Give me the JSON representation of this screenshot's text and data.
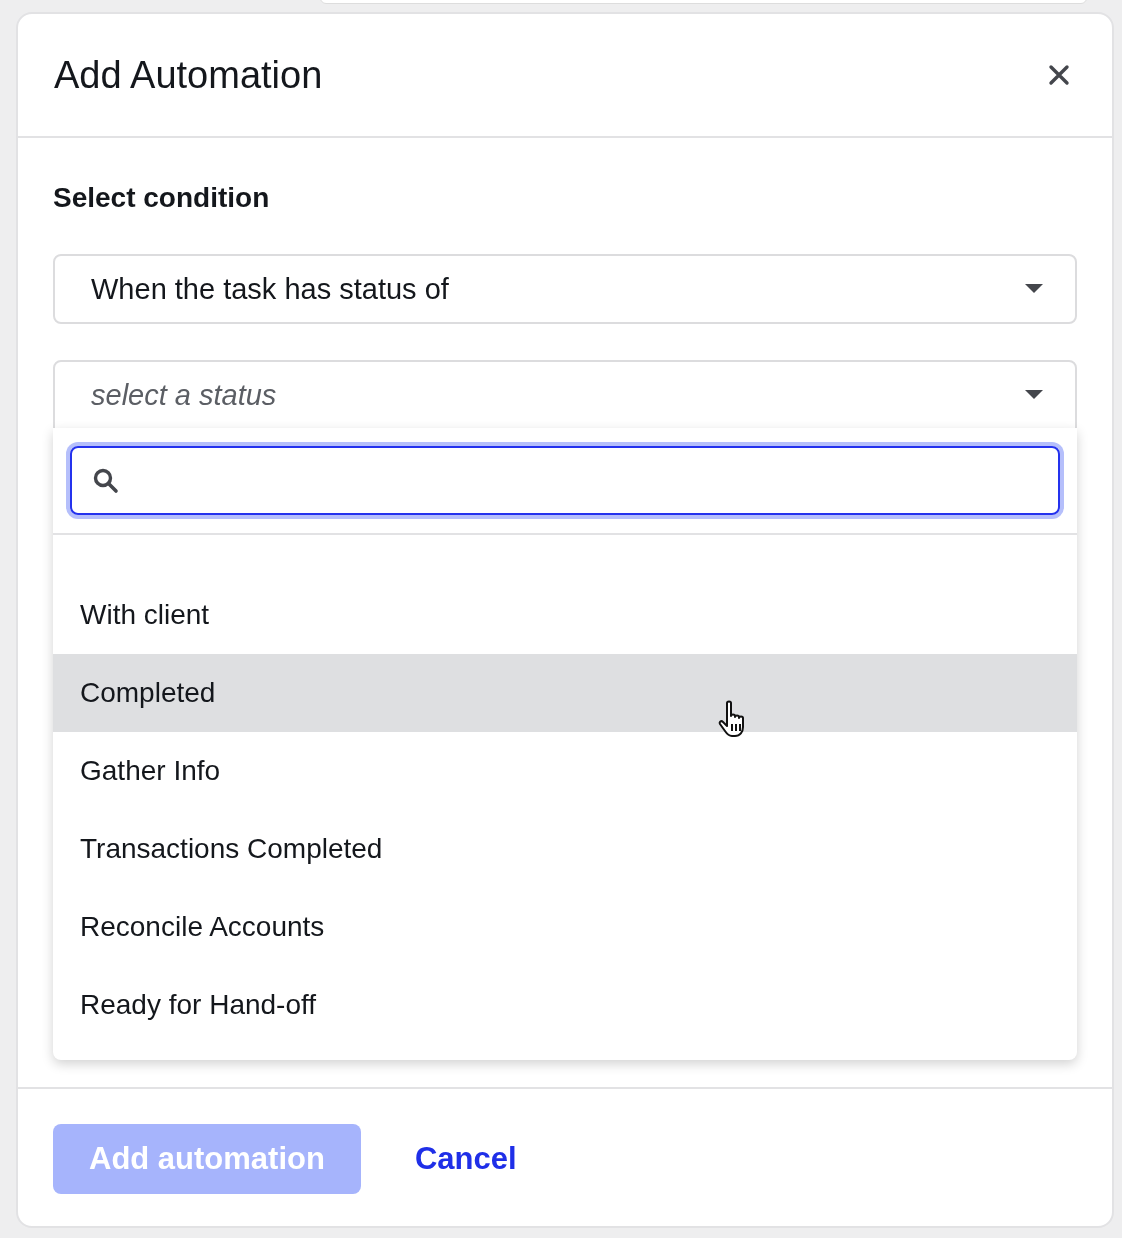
{
  "dialog": {
    "title": "Add Automation"
  },
  "section_label": "Select condition",
  "condition_select": {
    "value": "When the task has status of"
  },
  "status_select": {
    "placeholder": "select a status",
    "expanded": true
  },
  "status_search": {
    "focused": true
  },
  "status_options": [
    {
      "label": "With client",
      "highlighted": false
    },
    {
      "label": "Completed",
      "highlighted": true
    },
    {
      "label": "Gather Info",
      "highlighted": false
    },
    {
      "label": "Transactions Completed",
      "highlighted": false
    },
    {
      "label": "Reconcile Accounts",
      "highlighted": false
    },
    {
      "label": "Ready for Hand-off",
      "highlighted": false
    }
  ],
  "footer_buttons": [
    {
      "label": "Add automation",
      "kind": "primary",
      "disabled": true
    },
    {
      "label": "Cancel",
      "kind": "link",
      "disabled": false
    }
  ]
}
